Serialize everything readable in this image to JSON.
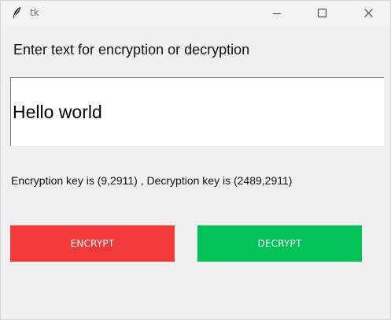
{
  "window": {
    "title": "tk"
  },
  "main": {
    "prompt": "Enter text for encryption or decryption",
    "input_value": "Hello world",
    "key_info": "Encryption key is (9,2911) , Decryption key is (2489,2911)",
    "encrypt_label": "ENCRYPT",
    "decrypt_label": "DECRYPT"
  },
  "colors": {
    "encrypt_button": "#f23a38",
    "decrypt_button": "#00c257",
    "background": "#f0f0f0"
  },
  "icons": {
    "app": "feather-icon",
    "minimize": "minimize-icon",
    "maximize": "maximize-icon",
    "close": "close-icon"
  }
}
